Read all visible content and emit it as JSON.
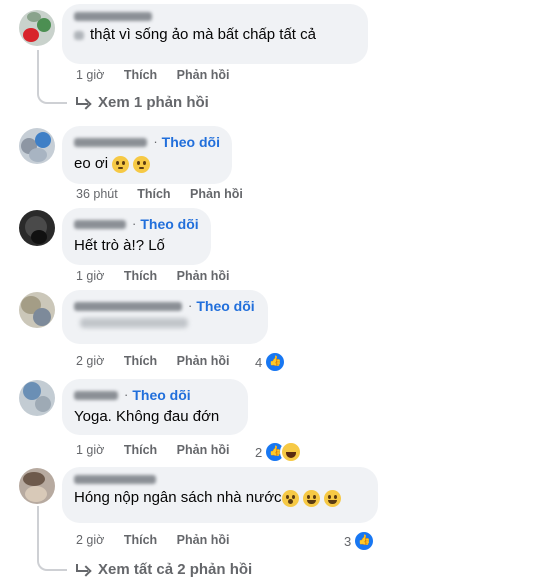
{
  "comments": [
    {
      "author": "",
      "text": "thật vì sống ảo mà bất chấp tất cả",
      "time": "1 giờ",
      "like_label": "Thích",
      "reply_label": "Phản hồi",
      "replies_link": "Xem 1 phản hồi"
    },
    {
      "author": "",
      "follow": "Theo dõi",
      "text": "eo ơi",
      "emojis": [
        "pleading-face-icon",
        "pleading-face-icon"
      ],
      "time": "36 phút",
      "like_label": "Thích",
      "reply_label": "Phản hồi"
    },
    {
      "author": "",
      "follow": "Theo dõi",
      "text": "Hết trò à!? Lố",
      "time": "1 giờ",
      "like_label": "Thích",
      "reply_label": "Phản hồi"
    },
    {
      "author": "",
      "follow": "Theo dõi",
      "text": "",
      "time": "2 giờ",
      "like_label": "Thích",
      "reply_label": "Phản hồi",
      "reaction_count": "4",
      "reactions": [
        "like-icon"
      ]
    },
    {
      "author": "",
      "follow": "Theo dõi",
      "text": "Yoga. Không đau đớn",
      "time": "1 giờ",
      "like_label": "Thích",
      "reply_label": "Phản hồi",
      "reaction_count": "2",
      "reactions": [
        "like-icon",
        "haha-icon"
      ]
    },
    {
      "author": "",
      "text": "Hóng nộp ngân sách nhà nước",
      "emojis": [
        "open-mouth-face-icon",
        "grinning-face-icon",
        "grinning-face-icon"
      ],
      "time": "2 giờ",
      "like_label": "Thích",
      "reply_label": "Phản hồi",
      "reaction_count": "3",
      "reactions": [
        "like-icon"
      ],
      "replies_link": "Xem tất cả 2 phản hồi"
    }
  ],
  "colors": {
    "bubble": "#f0f2f5",
    "follow": "#216fdb",
    "meta": "#65676b",
    "like": "#1877f2"
  }
}
